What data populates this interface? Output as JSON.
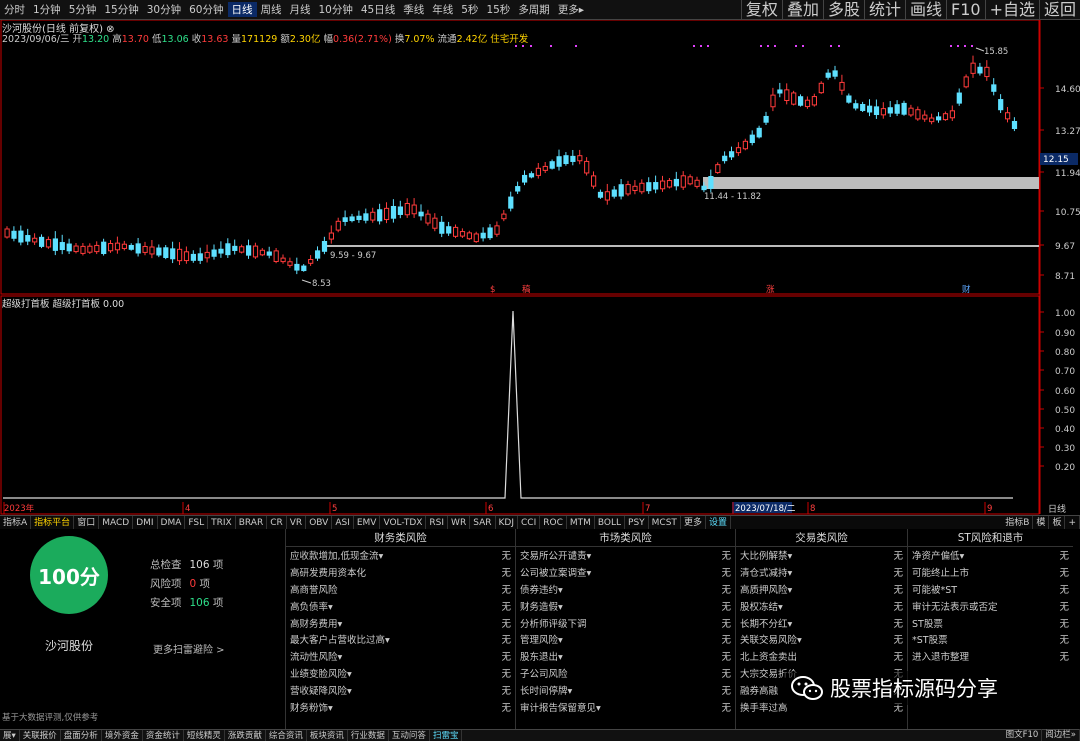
{
  "top_periods": [
    "分时",
    "1分钟",
    "5分钟",
    "15分钟",
    "30分钟",
    "60分钟",
    "日线",
    "周线",
    "月线",
    "10分钟",
    "45日线",
    "季线",
    "年线",
    "5秒",
    "15秒",
    "多周期",
    "更多▸"
  ],
  "top_active": "日线",
  "top_right": [
    "复权",
    "叠加",
    "多股",
    "统计",
    "画线",
    "F10",
    "+自选",
    "返回"
  ],
  "header": {
    "title": "沙河股份(日线 前复权) ⊗",
    "date": "2023/09/06/三",
    "open_l": "开",
    "open": "13.20",
    "high_l": "高",
    "high": "13.70",
    "low_l": "低",
    "low": "13.06",
    "close_l": "收",
    "close": "13.63",
    "vol_l": "量",
    "vol": "171129",
    "amt_l": "额",
    "amt": "2.30亿",
    "chg_l": "幅",
    "chg": "0.36(2.71%)",
    "turn_l": "换",
    "turn": "7.07%",
    "flow_l": "流通",
    "flow": "2.42亿",
    "ind_name": "住宅开发"
  },
  "price_axis": [
    "14.60",
    "13.27",
    "11.94",
    "10.75",
    "9.67",
    "8.71"
  ],
  "price_current": "12.15",
  "annotations": {
    "high": "15.85",
    "low": "8.53",
    "range1": "9.59 - 9.67",
    "range2": "11.44 - 11.82"
  },
  "event_marks": [
    "$",
    "稿",
    "涨",
    "财"
  ],
  "indicator_label": "超级打首板  超级打首板  0.00",
  "indicator_axis": [
    "1.00",
    "0.90",
    "0.80",
    "0.70",
    "0.60",
    "0.50",
    "0.40",
    "0.30",
    "0.20"
  ],
  "time_axis": [
    "2023年",
    "4",
    "5",
    "6",
    "7",
    "2023/07/18/二",
    "8",
    "9"
  ],
  "timeline_right": "日线",
  "tabs": [
    "指标A",
    "指标平台",
    "窗口",
    "MACD",
    "DMI",
    "DMA",
    "FSL",
    "TRIX",
    "BRAR",
    "CR",
    "VR",
    "OBV",
    "ASI",
    "EMV",
    "VOL-TDX",
    "RSI",
    "WR",
    "SAR",
    "KDJ",
    "CCI",
    "ROC",
    "MTM",
    "BOLL",
    "PSY",
    "MCST",
    "更多",
    "设置"
  ],
  "tabs_right": [
    "指标B",
    "模",
    "板",
    "+"
  ],
  "panel": {
    "score": "100分",
    "stock": "沙河股份",
    "total_l": "总检查",
    "total": "106",
    "total_u": "项",
    "risk_l": "风险项",
    "risk": "0",
    "risk_u": "项",
    "safe_l": "安全项",
    "safe": "106",
    "safe_u": "项",
    "more": "更多扫雷避险 >",
    "note": "基于大数据评测,仅供参考"
  },
  "risk_cols": [
    {
      "title": "财务类风险",
      "rows": [
        [
          "应收款增加,低现金流▾",
          "无"
        ],
        [
          "高研发费用资本化",
          "无"
        ],
        [
          "高商誉风险",
          "无"
        ],
        [
          "高负债率▾",
          "无"
        ],
        [
          "高财务费用▾",
          "无"
        ],
        [
          "最大客户占营收比过高▾",
          "无"
        ],
        [
          "流动性风险▾",
          "无"
        ],
        [
          "业绩变脸风险▾",
          "无"
        ],
        [
          "营收疑降风险▾",
          "无"
        ],
        [
          "财务粉饰▾",
          "无"
        ]
      ]
    },
    {
      "title": "市场类风险",
      "rows": [
        [
          "交易所公开谴责▾",
          "无"
        ],
        [
          "公司被立案调查▾",
          "无"
        ],
        [
          "债券违约▾",
          "无"
        ],
        [
          "财务造假▾",
          "无"
        ],
        [
          "分析师评级下调",
          "无"
        ],
        [
          "管理风险▾",
          "无"
        ],
        [
          "股东退出▾",
          "无"
        ],
        [
          "子公司风险",
          "无"
        ],
        [
          "长时间停牌▾",
          "无"
        ],
        [
          "审计报告保留意见▾",
          "无"
        ]
      ]
    },
    {
      "title": "交易类风险",
      "rows": [
        [
          "大比例解禁▾",
          "无"
        ],
        [
          "清仓式减持▾",
          "无"
        ],
        [
          "高质押风险▾",
          "无"
        ],
        [
          "股权冻结▾",
          "无"
        ],
        [
          "长期不分红▾",
          "无"
        ],
        [
          "关联交易风险▾",
          "无"
        ],
        [
          "北上资金卖出",
          "无"
        ],
        [
          "大宗交易折价",
          "无"
        ],
        [
          "融券高融",
          "无"
        ],
        [
          "换手率过高",
          "无"
        ]
      ]
    },
    {
      "title": "ST风险和退市",
      "rows": [
        [
          "净资产偏低▾",
          "无"
        ],
        [
          "可能终止上市",
          "无"
        ],
        [
          "可能被*ST",
          "无"
        ],
        [
          "审计无法表示或否定",
          "无"
        ],
        [
          "ST股票",
          "无"
        ],
        [
          "*ST股票",
          "无"
        ],
        [
          "进入退市整理",
          "无"
        ]
      ]
    }
  ],
  "watermark": "股票指标源码分享",
  "status": [
    "展▾",
    "关联报价",
    "盘面分析",
    "境外资金",
    "资金统计",
    "短线精灵",
    "涨跌贡献",
    "综合资讯",
    "板块资讯",
    "行业数据",
    "互动问答",
    "扫雷宝"
  ],
  "status_active": "扫雷宝",
  "status_right": [
    "图文F10",
    "阅边栏»"
  ]
}
